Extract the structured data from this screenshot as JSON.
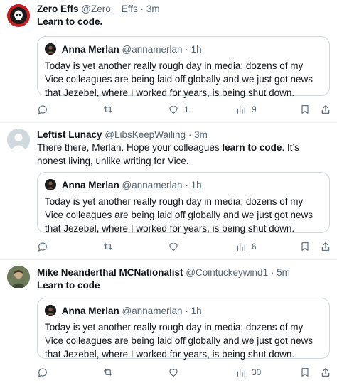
{
  "quoted_tweet": {
    "name": "Anna Merlan",
    "handle": "@annamerlan",
    "dot": "·",
    "time": "1h",
    "text": "Today is yet another really rough day in media; dozens of my Vice colleagues are being laid off globally and we just got news that Jezebel, where I worked for years, is being shut down."
  },
  "tweets": [
    {
      "name": "Zero Effs",
      "handle": "@Zero__Effs",
      "dot": "·",
      "time": "3m",
      "text": "Learn to code.",
      "actions": {
        "reply": "",
        "retweet": "",
        "like": "1",
        "views": "9"
      }
    },
    {
      "name": "Leftist Lunacy",
      "handle": "@LibsKeepWailing",
      "dot": "·",
      "time": "3m",
      "text_part1": "There there, Merlan. Hope your colleagues ",
      "text_bold": "learn to code",
      "text_part2": ". It’s honest living, unlike writing for Vice.",
      "actions": {
        "reply": "",
        "retweet": "",
        "like": "",
        "views": "6"
      }
    },
    {
      "name": "Mike Neanderthal MCNationalist",
      "handle": "@Cointuckeywind1",
      "dot": "·",
      "time": "5m",
      "text": "Learn to code",
      "actions": {
        "reply": "",
        "retweet": "",
        "like": "",
        "views": "30"
      }
    }
  ],
  "icons": [
    "reply-icon",
    "retweet-icon",
    "like-icon",
    "views-icon",
    "bookmark-icon",
    "share-icon"
  ],
  "colors": {
    "secondary_text": "#536471",
    "border": "#cfd9de",
    "divider": "#eff3f4"
  }
}
